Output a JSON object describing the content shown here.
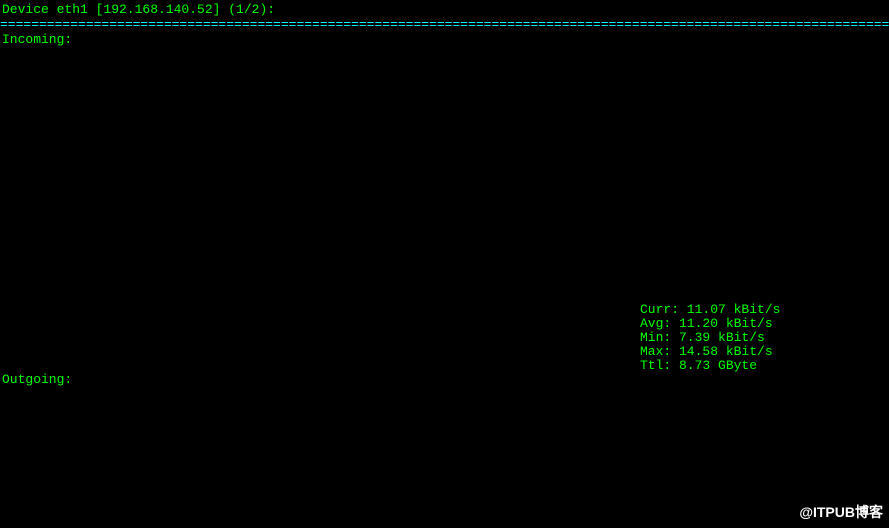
{
  "header": {
    "device_line": "Device eth1 [192.168.140.52] (1/2):",
    "divider": "================================================================================================================================"
  },
  "incoming": {
    "label": "Incoming:",
    "stats": {
      "curr": "Curr: 11.07 kBit/s",
      "avg": "Avg: 11.20 kBit/s",
      "min": "Min: 7.39 kBit/s",
      "max": "Max: 14.58 kBit/s",
      "ttl": "Ttl: 8.73 GByte"
    }
  },
  "outgoing": {
    "label": "Outgoing:"
  },
  "watermark": "@ITPUB博客"
}
